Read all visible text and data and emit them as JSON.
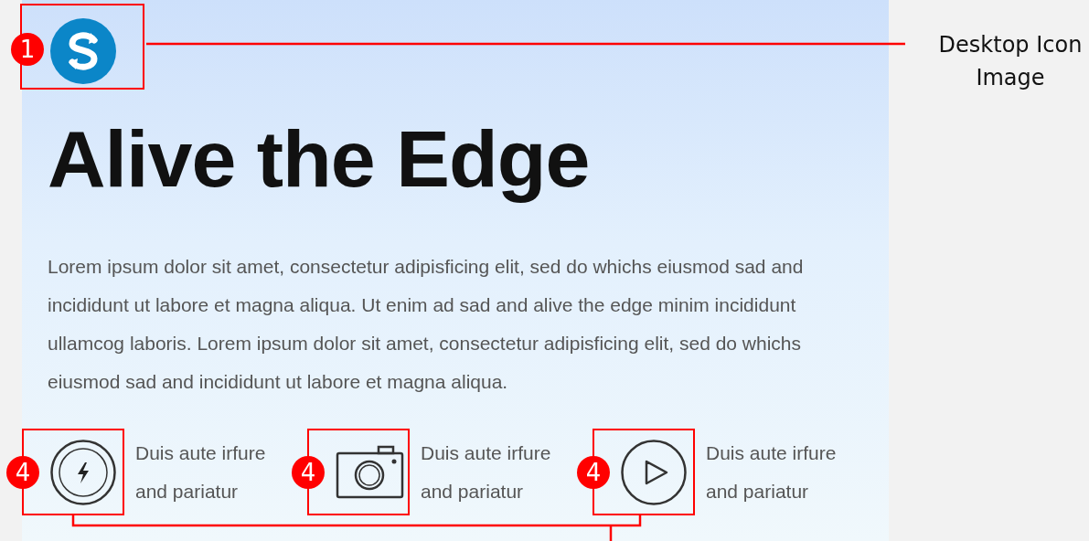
{
  "logo_callout": {
    "badge": "1",
    "label": "Desktop Icon Image"
  },
  "hero": {
    "heading": "Alive the Edge",
    "paragraph": "Lorem ipsum dolor sit amet, consectetur adipisficing elit, sed do whichs eiusmod sad and incididunt ut labore et magna aliqua. Ut enim ad sad and alive the edge minim incididunt ullamcog laboris. Lorem ipsum dolor sit amet, consectetur adipisficing elit, sed do whichs eiusmod sad and incididunt ut labore et magna aliqua."
  },
  "features": [
    {
      "kind": "bolt",
      "badge": "4",
      "text": "Duis aute irfure\nand pariatur"
    },
    {
      "kind": "camera",
      "badge": "4",
      "text": "Duis aute irfure\nand pariatur"
    },
    {
      "kind": "play",
      "badge": "4",
      "text": "Duis aute irfure\nand pariatur"
    }
  ]
}
